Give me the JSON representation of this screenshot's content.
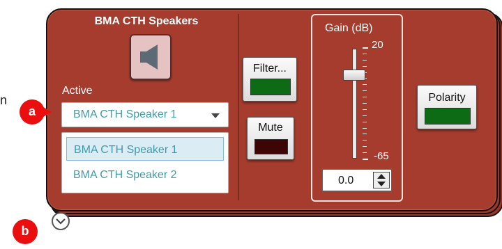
{
  "edge_text": "n",
  "panel": {
    "title": "BMA CTH Speakers",
    "speaker_icon": "speaker-icon",
    "active_label": "Active",
    "select": {
      "value": "BMA CTH Speaker 1",
      "options": [
        "BMA CTH Speaker 1",
        "BMA CTH Speaker 2"
      ]
    },
    "filter_label": "Filter...",
    "mute_label": "Mute",
    "polarity_label": "Polarity",
    "gain": {
      "title": "Gain  (dB)",
      "max_label": "20",
      "min_label": "-65",
      "value": "0.0"
    },
    "colors": {
      "panel": "#a63c2e",
      "indicator_on": "#0d6b16",
      "indicator_mute": "#3d0505",
      "badge": "#ea0e0e"
    }
  },
  "badges": {
    "a": "a",
    "b": "b"
  },
  "expander_icon": "chevron-down-icon"
}
